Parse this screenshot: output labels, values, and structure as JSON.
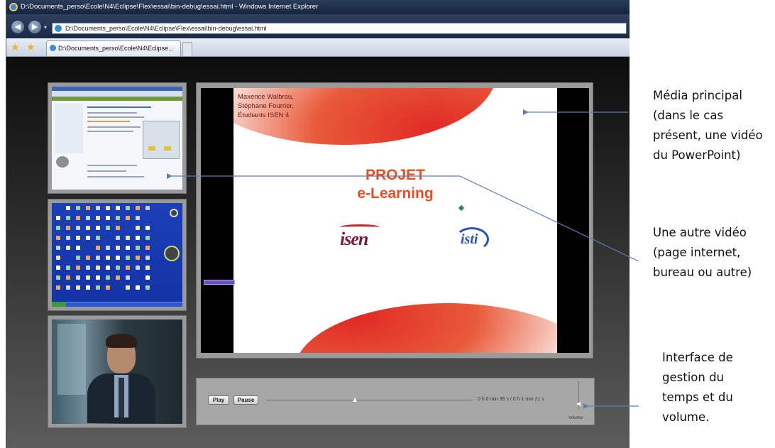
{
  "browser": {
    "title": "D:\\Documents_perso\\Ecole\\N4\\Eclipse\\Flex\\essai\\bin-debug\\essai.html - Windows Internet Explorer",
    "address": "D:\\Documents_perso\\Ecole\\N4\\Eclipse\\Flex\\essai\\bin-debug\\essai.html",
    "tab_label": "D:\\Documents_perso\\Ecole\\N4\\Eclipse..."
  },
  "main_media": {
    "authors": [
      "Maxence Walbrou,",
      "Stéphane Fourrier,",
      "Étudiants ISEN 4"
    ],
    "title_line1": "PROJET",
    "title_line2": "e-Learning",
    "logo_isen": "isen",
    "logo_isti": "isti"
  },
  "controls": {
    "play_label": "Play",
    "pause_label": "Pause",
    "time": "0 h 0 min 35 s  / 0 h 1 min 21 s",
    "volume_label": "Volume",
    "progress_fraction": 0.43,
    "volume_fraction": 0.2
  },
  "annotations": {
    "main_media": "Média principal\n(dans le cas\nprésent, une vidéo\ndu PowerPoint)",
    "other_video": "Une autre vidéo\n(page internet,\nbureau ou autre)",
    "time_interface": "Interface de\ngestion du\ntemps et du\nvolume."
  },
  "colors": {
    "slide_red": "#e02a24",
    "slide_title": "#e2502a",
    "arrow": "#5b7fb5"
  },
  "icons": {
    "back": "back-arrow-icon",
    "forward": "forward-arrow-icon",
    "favorites": "star-icon",
    "add_favorite": "add-favorite-icon"
  }
}
